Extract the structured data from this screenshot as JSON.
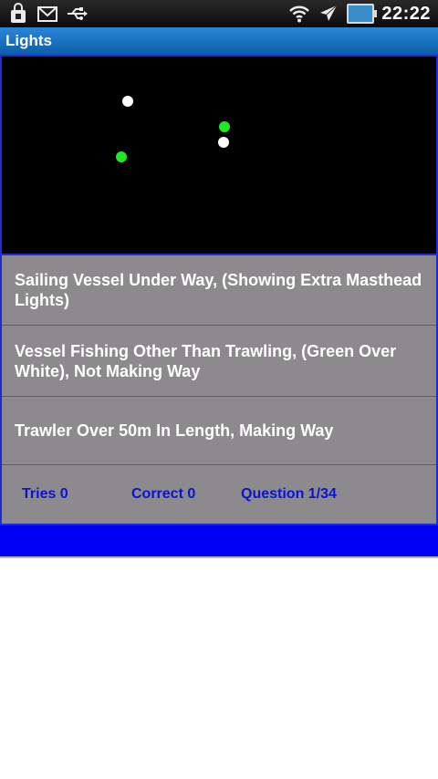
{
  "status_bar": {
    "time": "22:22",
    "left_icons": [
      "bag-icon",
      "gmail-icon",
      "usb-icon"
    ],
    "right_icons": [
      "wifi-icon",
      "airplane-mode-icon",
      "battery-icon"
    ]
  },
  "title_bar": {
    "title": "Lights"
  },
  "lights_display": {
    "background": "#000000",
    "lights": [
      {
        "color": "#ffffff",
        "name": "white-light-top-left"
      },
      {
        "color": "#22e822",
        "name": "green-light-left"
      },
      {
        "color": "#22e822",
        "name": "green-light-right"
      },
      {
        "color": "#ffffff",
        "name": "white-light-right"
      }
    ]
  },
  "answers": [
    {
      "label": "Sailing Vessel Under Way, (Showing Extra Masthead Lights)"
    },
    {
      "label": "Vessel Fishing Other Than Trawling, (Green Over White), Not Making Way"
    },
    {
      "label": "Trawler Over 50m In Length, Making Way"
    }
  ],
  "stats": {
    "tries": "Tries 0",
    "correct": "Correct 0",
    "question": "Question 1/34"
  },
  "colors": {
    "accent_blue": "#1f2ad8",
    "stat_text": "#0a12d8",
    "answer_bg": "#8c8a8c",
    "bottom_bar": "#0000f4"
  }
}
